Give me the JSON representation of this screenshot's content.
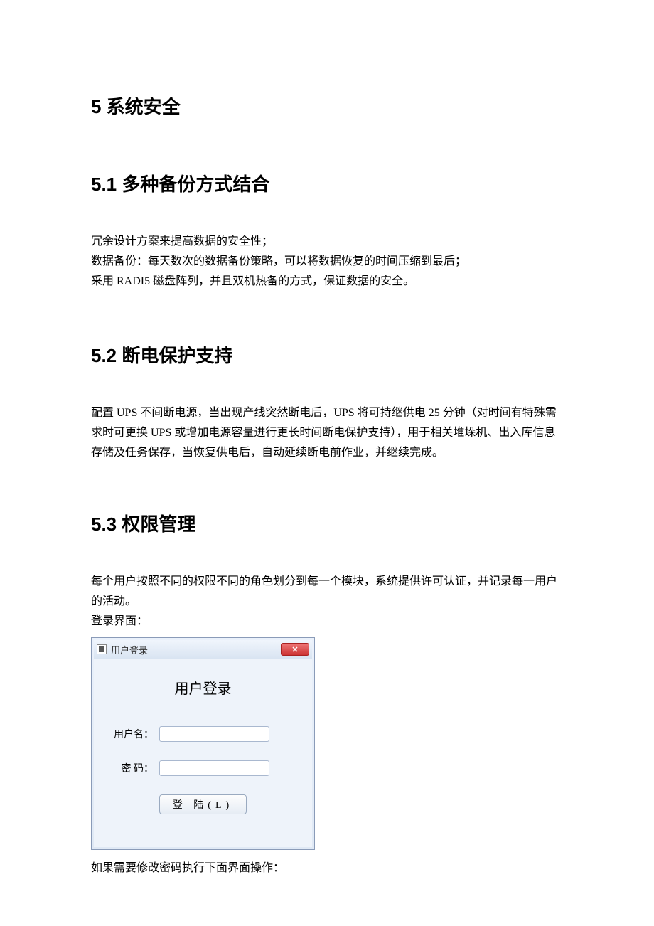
{
  "h1": "5 系统安全",
  "sections": {
    "s1": {
      "title": "5.1 多种备份方式结合",
      "p1": "冗余设计方案来提高数据的安全性；",
      "p2": "数据备份：每天数次的数据备份策略，可以将数据恢复的时间压缩到最后；",
      "p3": "采用 RADI5 磁盘阵列，并且双机热备的方式，保证数据的安全。"
    },
    "s2": {
      "title": "5.2 断电保护支持",
      "p1": "配置 UPS 不间断电源，当出现产线突然断电后，UPS 将可持继供电 25 分钟（对时间有特殊需求时可更换 UPS 或增加电源容量进行更长时间断电保护支持），用于相关堆垛机、出入库信息存储及任务保存，当恢复供电后，自动延续断电前作业，并继续完成。"
    },
    "s3": {
      "title": "5.3 权限管理",
      "p1": "每个用户按照不同的权限不同的角色划分到每一个模块，系统提供许可认证，并记录每一用户的活动。",
      "p2": "登录界面：",
      "after": "如果需要修改密码执行下面界面操作："
    }
  },
  "login": {
    "titlebar": "用户登录",
    "close_symbol": "✕",
    "heading": "用户登录",
    "username_label": "用户名：",
    "password_label": "密 码：",
    "button_label": "登   陆(L)"
  }
}
